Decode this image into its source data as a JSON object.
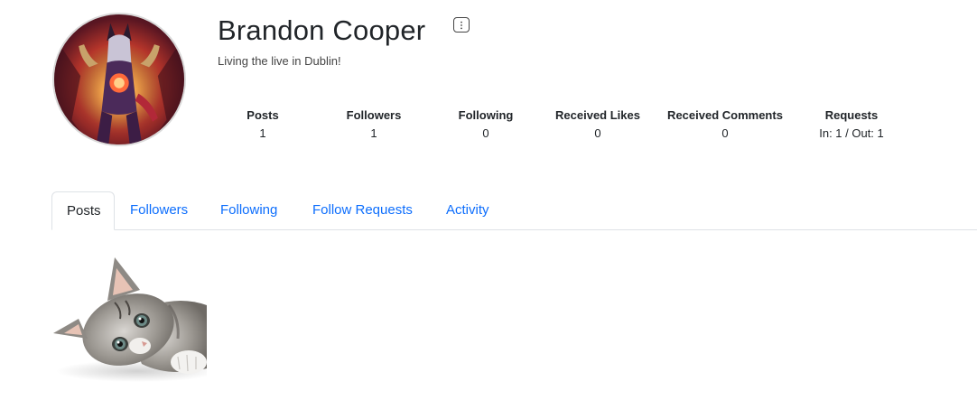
{
  "profile": {
    "name": "Brandon Cooper",
    "bio": "Living the live in Dublin!",
    "avatar_icon": "avatar-image",
    "more_icon": "more-vertical-icon"
  },
  "stats": [
    {
      "label": "Posts",
      "value": "1"
    },
    {
      "label": "Followers",
      "value": "1"
    },
    {
      "label": "Following",
      "value": "0"
    },
    {
      "label": "Received Likes",
      "value": "0"
    },
    {
      "label": "Received Comments",
      "value": "0"
    },
    {
      "label": "Requests",
      "value": "In: 1 / Out: 1"
    }
  ],
  "tabs": [
    {
      "label": "Posts",
      "active": true
    },
    {
      "label": "Followers",
      "active": false
    },
    {
      "label": "Following",
      "active": false
    },
    {
      "label": "Follow Requests",
      "active": false
    },
    {
      "label": "Activity",
      "active": false
    }
  ],
  "posts": [
    {
      "image": "kitten-photo"
    }
  ],
  "colors": {
    "link": "#0d6efd",
    "text": "#212529",
    "border": "#dee2e6"
  }
}
